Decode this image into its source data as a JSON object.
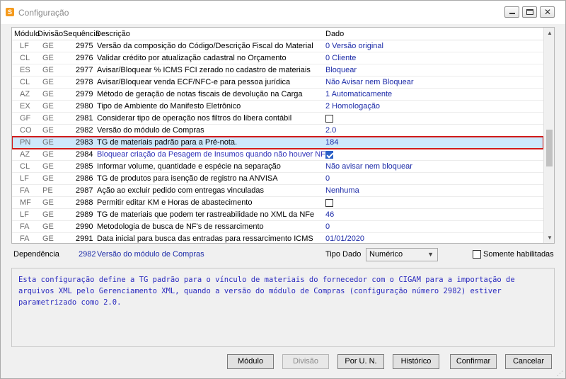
{
  "window": {
    "title": "Configuração",
    "app_icon_glyph": "S",
    "minimize_glyph": "",
    "close_glyph": "✕"
  },
  "grid": {
    "columns": [
      "Módulo",
      "Divisão",
      "Sequência",
      "Descrição",
      "Dado"
    ],
    "rows": [
      {
        "modulo": "LF",
        "divisao": "GE",
        "sequencia": "2975",
        "descricao": "Versão da composição do Código/Descrição Fiscal do Material",
        "dado": "0 Versão original"
      },
      {
        "modulo": "CL",
        "divisao": "GE",
        "sequencia": "2976",
        "descricao": "Validar crédito por atualização cadastral no Orçamento",
        "dado": "0 Cliente"
      },
      {
        "modulo": "ES",
        "divisao": "GE",
        "sequencia": "2977",
        "descricao": "Avisar/Bloquear % ICMS FCI zerado no cadastro de materiais",
        "dado": "Bloquear"
      },
      {
        "modulo": "CL",
        "divisao": "GE",
        "sequencia": "2978",
        "descricao": "Avisar/Bloquear venda ECF/NFC-e para pessoa jurídica",
        "dado": "Não Avisar nem Bloquear"
      },
      {
        "modulo": "AZ",
        "divisao": "GE",
        "sequencia": "2979",
        "descricao": "Método de geração de notas fiscais de devolução na Carga",
        "dado": "1 Automaticamente"
      },
      {
        "modulo": "EX",
        "divisao": "GE",
        "sequencia": "2980",
        "descricao": "Tipo de Ambiente do Manifesto Eletrônico",
        "dado": "2 Homologação"
      },
      {
        "modulo": "GF",
        "divisao": "GE",
        "sequencia": "2981",
        "descricao": "Considerar tipo de operação nos filtros do libera contábil",
        "dado": "",
        "checkbox": "unchecked"
      },
      {
        "modulo": "CO",
        "divisao": "GE",
        "sequencia": "2982",
        "descricao": "Versão do módulo de Compras",
        "dado": "2.0"
      },
      {
        "modulo": "PN",
        "divisao": "GE",
        "sequencia": "2983",
        "descricao": "TG de materiais padrão para a Pré-nota.",
        "dado": "184",
        "selected": true
      },
      {
        "modulo": "AZ",
        "divisao": "GE",
        "sequencia": "2984",
        "descricao": "Bloquear criação da Pesagem de Insumos quando não houver NFE",
        "dado": "",
        "checkbox": "checked",
        "blue_desc": true
      },
      {
        "modulo": "CL",
        "divisao": "GE",
        "sequencia": "2985",
        "descricao": "Informar volume, quantidade e espécie na separação",
        "dado": "Não avisar nem bloquear"
      },
      {
        "modulo": "LF",
        "divisao": "GE",
        "sequencia": "2986",
        "descricao": "TG de produtos para isenção de registro na ANVISA",
        "dado": "0"
      },
      {
        "modulo": "FA",
        "divisao": "PE",
        "sequencia": "2987",
        "descricao": "Ação ao excluir pedido com entregas vinculadas",
        "dado": "Nenhuma"
      },
      {
        "modulo": "MF",
        "divisao": "GE",
        "sequencia": "2988",
        "descricao": "Permitir editar KM e Horas de abastecimento",
        "dado": "",
        "checkbox": "unchecked"
      },
      {
        "modulo": "LF",
        "divisao": "GE",
        "sequencia": "2989",
        "descricao": "TG de materiais que podem ter rastreabilidade no XML da NFe",
        "dado": "46"
      },
      {
        "modulo": "FA",
        "divisao": "GE",
        "sequencia": "2990",
        "descricao": "Metodologia de busca de NF's de ressarcimento",
        "dado": "0"
      },
      {
        "modulo": "FA",
        "divisao": "GE",
        "sequencia": "2991",
        "descricao": "Data inicial para busca das entradas para ressarcimento ICMS",
        "dado": "01/01/2020"
      }
    ]
  },
  "dependencia": {
    "label": "Dependência",
    "numero": "2982",
    "descricao": "Versão do módulo de Compras"
  },
  "tipo_dado": {
    "label": "Tipo Dado",
    "value": "Numérico"
  },
  "somente_habilitadas": {
    "label": "Somente habilitadas",
    "checked": false
  },
  "descricao_panel": {
    "text": "Esta configuração define a TG padrão para o vínculo de materiais do fornecedor com o CIGAM para a importação de arquivos XML pelo Gerenciamento XML, quando a versão do módulo de Compras (configuração número 2982) estiver parametrizado como 2.0."
  },
  "buttons": {
    "modulo": "Módulo",
    "divisao": "Divisão",
    "por_un": "Por U. N.",
    "historico": "Histórico",
    "confirmar": "Confirmar",
    "cancelar": "Cancelar"
  },
  "icons": {
    "app": "app-icon",
    "minimize": "minimize-icon",
    "maximize": "maximize-icon",
    "close": "close-icon",
    "scroll_up": "scroll-up-icon",
    "scroll_down": "scroll-down-icon",
    "dropdown": "chevron-down-icon"
  },
  "colors": {
    "selection_background": "#cde8fb",
    "selection_outline": "#d11a1a",
    "value_text": "#1c2ba8",
    "checkbox_checked": "#2b61c7",
    "description_text": "#2a2abf"
  }
}
